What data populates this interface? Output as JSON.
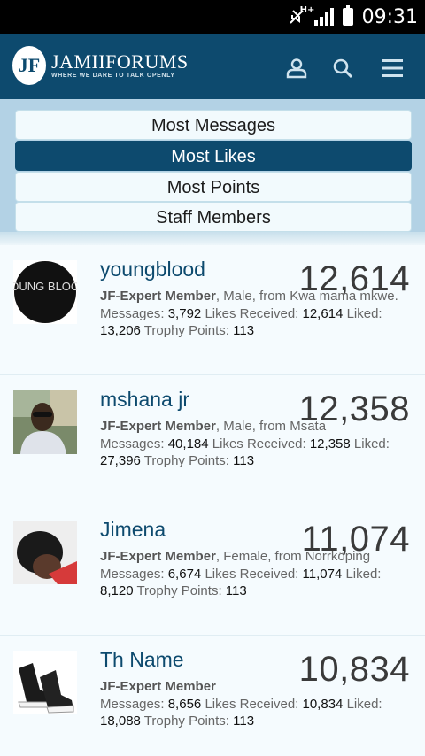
{
  "status": {
    "time": "09:31",
    "network": "H+"
  },
  "header": {
    "logo_letters": "JF",
    "logo_title": "JAMIIFORUMS",
    "logo_tagline": "WHERE WE DARE TO TALK OPENLY"
  },
  "tabs": [
    {
      "label": "Most Messages",
      "active": false
    },
    {
      "label": "Most Likes",
      "active": true
    },
    {
      "label": "Most Points",
      "active": false
    },
    {
      "label": "Staff Members",
      "active": false
    }
  ],
  "labels": {
    "messages": "Messages:",
    "likes_received": "Likes Received:",
    "liked": "Liked:",
    "trophy": "Trophy Points:"
  },
  "members": [
    {
      "name": "youngblood",
      "score": "12,614",
      "rank": "JF-Expert Member",
      "details": ", Male, from Kwa mama mkwe.",
      "messages": "3,792",
      "likes_received": "12,614",
      "liked": "13,206",
      "trophy": "113",
      "avatar_text": "YOUNG BLOOD"
    },
    {
      "name": "mshana jr",
      "score": "12,358",
      "rank": "JF-Expert Member",
      "details": ", Male, from Msata",
      "messages": "40,184",
      "likes_received": "12,358",
      "liked": "27,396",
      "trophy": "113"
    },
    {
      "name": "Jimena",
      "score": "11,074",
      "rank": "JF-Expert Member",
      "details": ", Female, from Norrköping",
      "messages": "6,674",
      "likes_received": "11,074",
      "liked": "8,120",
      "trophy": "113"
    },
    {
      "name": "Th Name",
      "score": "10,834",
      "rank": "JF-Expert Member",
      "details": "",
      "messages": "8,656",
      "likes_received": "10,834",
      "liked": "18,088",
      "trophy": "113"
    }
  ]
}
